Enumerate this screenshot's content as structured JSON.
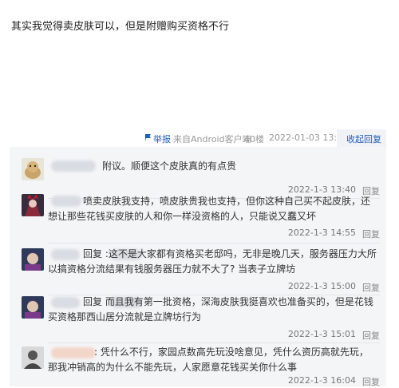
{
  "post": {
    "text": "其实我觉得卖皮肤可以，但是附赠购买资格不行"
  },
  "meta": {
    "report": "举报",
    "client": "来自Android客户端",
    "floor": "40楼",
    "time": "2022-01-03 13:25",
    "collapse": "收起回复"
  },
  "replies": [
    {
      "text": "附议。顺便这个皮肤真的有点贵",
      "time": "2022-1-3 13:40",
      "reply_label": "回复"
    },
    {
      "text": "喷卖皮肤我支持，喷皮肤贵我也支持，但你这种自己买不起皮肤，还想让那些花钱买皮肤的人和你一样没资格的人，只能说又蠢又坏",
      "time": "2022-1-3 14:55",
      "reply_label": "回复"
    },
    {
      "text": "回复 :这不是大家都有资格买老邸吗，无非是晚几天，服务器压力大所以搞资格分流结果有钱服务器压力就不大了? 当表子立牌坊",
      "time": "2022-1-3 15:00",
      "reply_label": "回复"
    },
    {
      "text": "回复 而且我有第一批资格，深海皮肤我挺喜欢也准备买的，但是花钱买资格那西山居分流就是立牌坊行为",
      "time": "2022-1-3 15:01",
      "reply_label": "回复"
    },
    {
      "text": ": 凭什么不行，家园点数高先玩没啥意见，凭什么资历高就先玩，那我冲销高的为什么不能先玩，人家愿意花钱买关你什么事",
      "time": "2022-1-3 16:04",
      "reply_label": "回复"
    }
  ]
}
